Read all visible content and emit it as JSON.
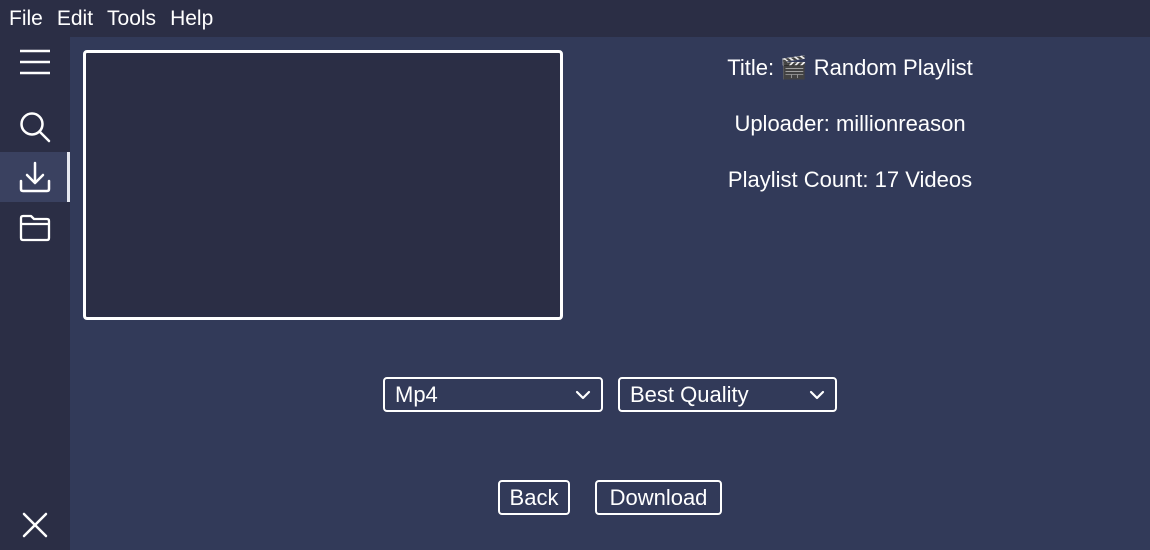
{
  "menubar": {
    "items": [
      {
        "label": "File"
      },
      {
        "label": "Edit"
      },
      {
        "label": "Tools"
      },
      {
        "label": "Help"
      }
    ]
  },
  "sidebar": {
    "icons": [
      "hamburger-menu-icon",
      "search-icon",
      "download-icon",
      "folder-icon",
      "close-icon"
    ],
    "active": "download"
  },
  "info": {
    "title_label": "Title:",
    "title_emoji": "🎬",
    "title_value": "Random Playlist",
    "uploader": "Uploader: millionreason",
    "playlist_count": "Playlist Count: 17 Videos"
  },
  "options": {
    "format_selected": "Mp4",
    "quality_selected": "Best Quality"
  },
  "actions": {
    "back_label": "Back",
    "download_label": "Download"
  },
  "colors": {
    "background": "#323a59",
    "sidebar": "#2b2e45",
    "thumbnail": "#2b2e45",
    "foreground": "#ffffff"
  }
}
